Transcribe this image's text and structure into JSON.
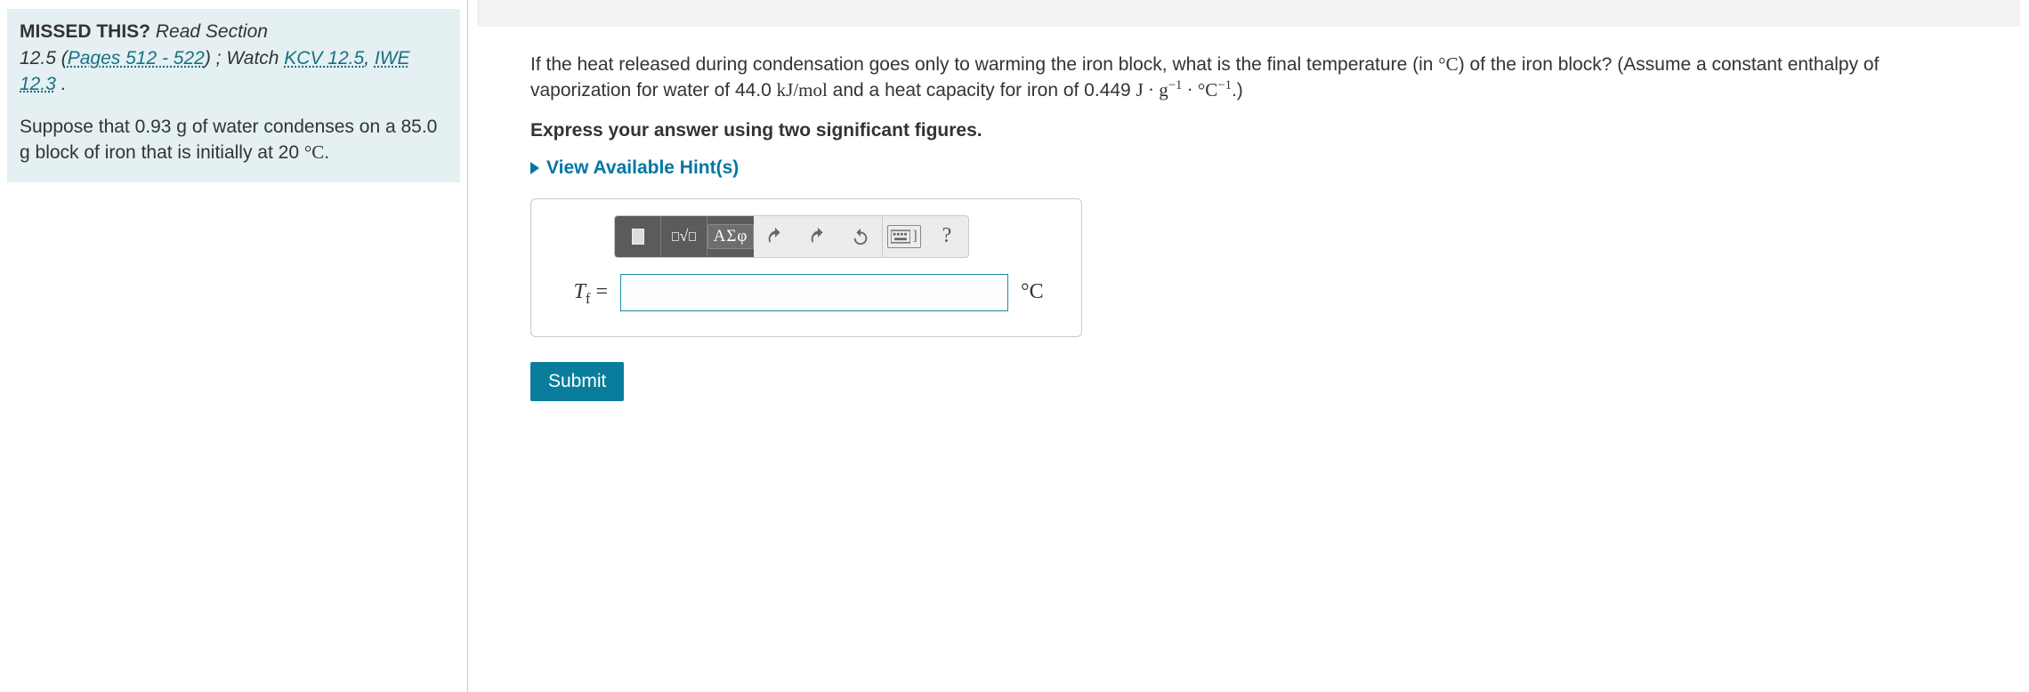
{
  "sidebar": {
    "missed_label": "MISSED THIS?",
    "read_section": "Read Section",
    "section_ref": "12.5 (",
    "pages_link": "Pages 512 - 522",
    "after_pages": ") ; Watch ",
    "kcv_link": "KCV 12.5",
    "comma": ", ",
    "iwe_link": "IWE 12.3",
    "period": " .",
    "problem_text_a": "Suppose that 0.93 g of water condenses on a 85.0 g block of iron that is initially at 20 ",
    "problem_text_unit": "°C",
    "problem_text_b": "."
  },
  "question": {
    "line1a": "If the heat released during condensation goes only to warming the iron block, what is the final temperature (in ",
    "unit1": "°C",
    "line1b": ") of the iron block? (Assume a constant enthalpy of vaporization for water of 44.0 ",
    "kjmol": "kJ/mol",
    "line1c": " and a heat capacity for iron of 0.449 ",
    "jgc": "J · g⁻¹ · °C⁻¹",
    "line1d": ".)",
    "instruction": "Express your answer using two significant figures.",
    "hints_label": "View Available Hint(s)"
  },
  "toolbar": {
    "greek": "ΑΣφ",
    "help": "?",
    "keyboard_hint": "⌨ ]"
  },
  "answer": {
    "lhs_var": "T",
    "lhs_sub": "f",
    "lhs_eq": " = ",
    "value": "",
    "unit": "°C"
  },
  "submit_label": "Submit"
}
